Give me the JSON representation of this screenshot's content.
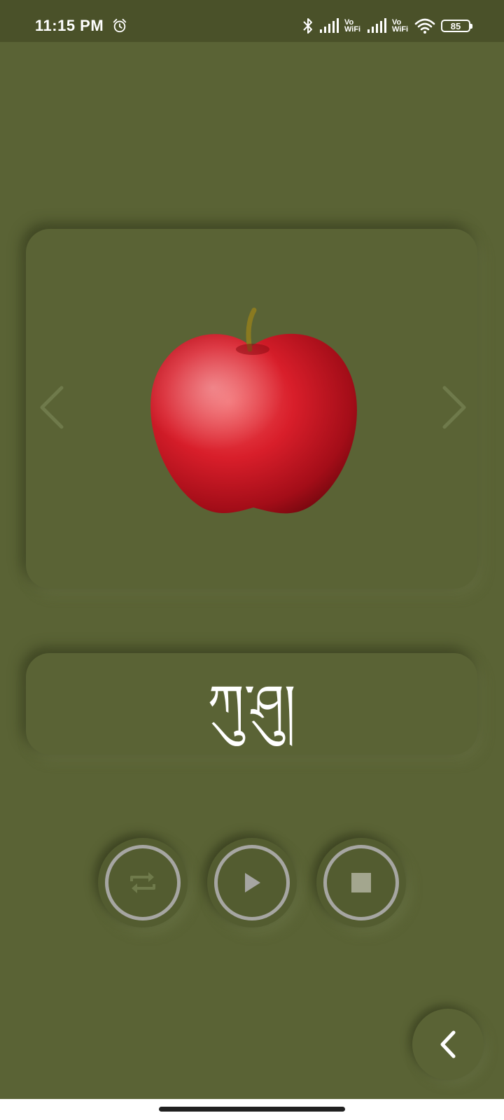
{
  "status_bar": {
    "time": "11:15 PM",
    "alarm_icon": "alarm-clock-icon",
    "bluetooth_icon": "bluetooth-icon",
    "signal_icon": "cell-signal-icon",
    "vo_wifi_label_1": "Vo",
    "vo_wifi_label_2": "WiFi",
    "wifi_icon": "wifi-icon",
    "battery_level": "85"
  },
  "flashcard": {
    "image_icon": "red-apple-image",
    "prev_icon": "chevron-left-icon",
    "next_icon": "chevron-right-icon",
    "word": "ཀུ་ཤུ།"
  },
  "controls": {
    "repeat_icon": "repeat-icon",
    "play_icon": "play-icon",
    "stop_icon": "stop-icon"
  },
  "back_button": {
    "icon": "back-arrow-icon"
  },
  "colors": {
    "background": "#5a6335",
    "status_bar": "#4a5129",
    "ring": "#a6a6a2",
    "word_text": "#ffffff"
  }
}
